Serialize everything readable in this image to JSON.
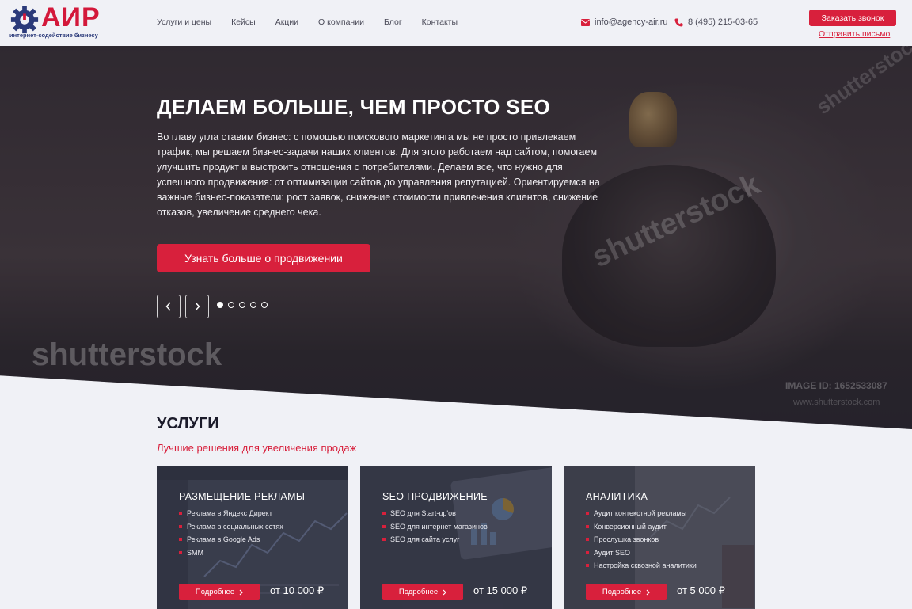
{
  "header": {
    "logo_text": "АИР",
    "logo_sub": "интернет-содействие бизнесу",
    "nav": [
      "Услуги и цены",
      "Кейсы",
      "Акции",
      "О компании",
      "Блог",
      "Контакты"
    ],
    "email": "info@agency-air.ru",
    "phone": "8 (495) 215-03-65",
    "call_button": "Заказать звонок",
    "mail_link": "Отправить письмо"
  },
  "hero": {
    "title": "ДЕЛАЕМ БОЛЬШЕ, ЧЕМ ПРОСТО SEO",
    "text": "Во главу угла ставим бизнес: с помощью поискового маркетинга мы не просто привлекаем трафик, мы решаем бизнес-задачи наших клиентов. Для этого работаем над сайтом, помогаем улучшить продукт и выстроить отношения с потребителями. Делаем все, что нужно для успешного продвижения: от оптимизации сайтов до управления репутацией. Ориентируемся на важные бизнес-показатели: рост заявок, снижение стоимости привлечения клиентов, снижение отказов, увеличение среднего чека.",
    "button": "Узнать больше о продвижении",
    "slides_total": 5,
    "slide_active": 1,
    "watermark": "shutterstock",
    "image_id": "IMAGE ID: 1652533087",
    "image_site": "www.shutterstock.com"
  },
  "services": {
    "title": "УСЛУГИ",
    "subtitle": "Лучшие решения для увеличения продаж",
    "cards": [
      {
        "title": "РАЗМЕЩЕНИЕ РЕКЛАМЫ",
        "items": [
          "Реклама в Яндекс Директ",
          "Реклама в социальных сетях",
          "Реклама в Google Ads",
          "SMM"
        ],
        "button": "Подробнее",
        "price": "от 10 000 ₽"
      },
      {
        "title": "SEO ПРОДВИЖЕНИЕ",
        "items": [
          "SEO для Start-up'ов",
          "SEO для интернет магазинов",
          "SEO для сайта услуг"
        ],
        "button": "Подробнее",
        "price": "от 15 000 ₽"
      },
      {
        "title": "АНАЛИТИКА",
        "items": [
          "Аудит контекстной рекламы",
          "Конверсионный аудит",
          "Прослушка звонков",
          "Аудит SEO",
          "Настройка сквозной аналитики"
        ],
        "button": "Подробнее",
        "price": "от 5 000 ₽"
      }
    ]
  },
  "colors": {
    "accent": "#d8203c",
    "brand_blue": "#2b3a7a",
    "page_bg": "#f0f1f6"
  }
}
